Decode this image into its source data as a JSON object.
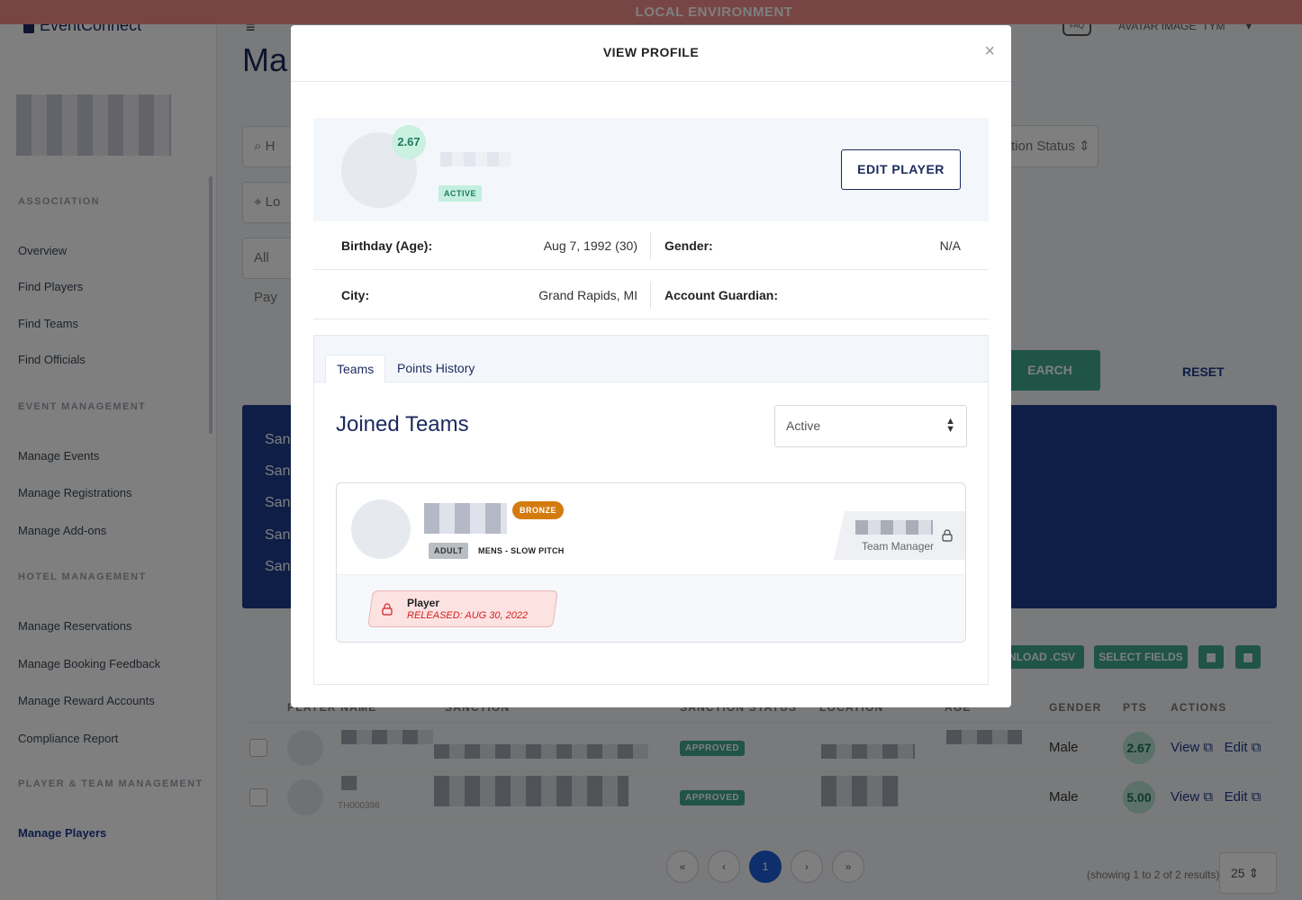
{
  "env_banner": "LOCAL ENVIRONMENT",
  "app": {
    "logo": "EventConnect",
    "faq": "FAQ",
    "avatar_alt": "AVATAR IMAGE",
    "user_initials": "TYM"
  },
  "sidebar": {
    "sections": [
      {
        "label": "ASSOCIATION",
        "items": [
          "Overview",
          "Find Players",
          "Find Teams",
          "Find Officials"
        ]
      },
      {
        "label": "EVENT MANAGEMENT",
        "items": [
          "Manage Events",
          "Manage Registrations",
          "Manage Add-ons"
        ]
      },
      {
        "label": "HOTEL MANAGEMENT",
        "items": [
          "Manage Reservations",
          "Manage Booking Feedback",
          "Manage Reward Accounts",
          "Compliance Report"
        ]
      },
      {
        "label": "PLAYER & TEAM MANAGEMENT",
        "items": [
          "Manage Players"
        ]
      }
    ],
    "active_item": "Manage Players"
  },
  "background": {
    "page_title_partial": "Ma",
    "search_placeholder_partial": "H",
    "location_placeholder_partial": "Lo",
    "players_filter_partial": "All Pay",
    "sanction_status_partial": "tion Status",
    "search_button_partial": "EARCH",
    "reset_button": "RESET",
    "panel_rows_partial": [
      "San",
      "San",
      "San",
      "San",
      "San"
    ],
    "toolbar": {
      "download_partial": "NLOAD .CSV",
      "select_fields": "SELECT FIELDS"
    },
    "table_headers": [
      "PLAYER NAME",
      "SANCTION",
      "SANCTION STATUS",
      "LOCATION",
      "AGE",
      "GENDER",
      "PTS",
      "ACTIONS"
    ],
    "rows": [
      {
        "status": "APPROVED",
        "gender": "Male",
        "pts": "2.67",
        "view": "View",
        "edit": "Edit"
      },
      {
        "status": "APPROVED",
        "gender": "Male",
        "pts": "5.00",
        "view": "View",
        "edit": "Edit",
        "id_partial": "TH000398"
      }
    ],
    "pagination": {
      "first": "«",
      "prev": "‹",
      "current": "1",
      "next": "›",
      "last": "»"
    },
    "results_text": "(showing 1 to 2 of 2 results)",
    "per_page": "25"
  },
  "modal": {
    "title": "VIEW PROFILE",
    "close": "×",
    "profile": {
      "score": "2.67",
      "status": "ACTIVE",
      "edit_button": "EDIT PLAYER"
    },
    "info": {
      "birthday_label": "Birthday (Age):",
      "birthday_value": "Aug 7, 1992 (30)",
      "gender_label": "Gender:",
      "gender_value": "N/A",
      "city_label": "City:",
      "city_value": "Grand Rapids, MI",
      "guardian_label": "Account Guardian:",
      "guardian_value": ""
    },
    "tabs": [
      "Teams",
      "Points History"
    ],
    "active_tab": "Teams",
    "joined_title": "Joined Teams",
    "team_filter": "Active",
    "team": {
      "tier": "BRONZE",
      "age_group": "ADULT",
      "division": "MENS - SLOW PITCH",
      "manager_role": "Team Manager",
      "player_role": "Player",
      "player_status": "RELEASED: AUG 30, 2022"
    }
  }
}
